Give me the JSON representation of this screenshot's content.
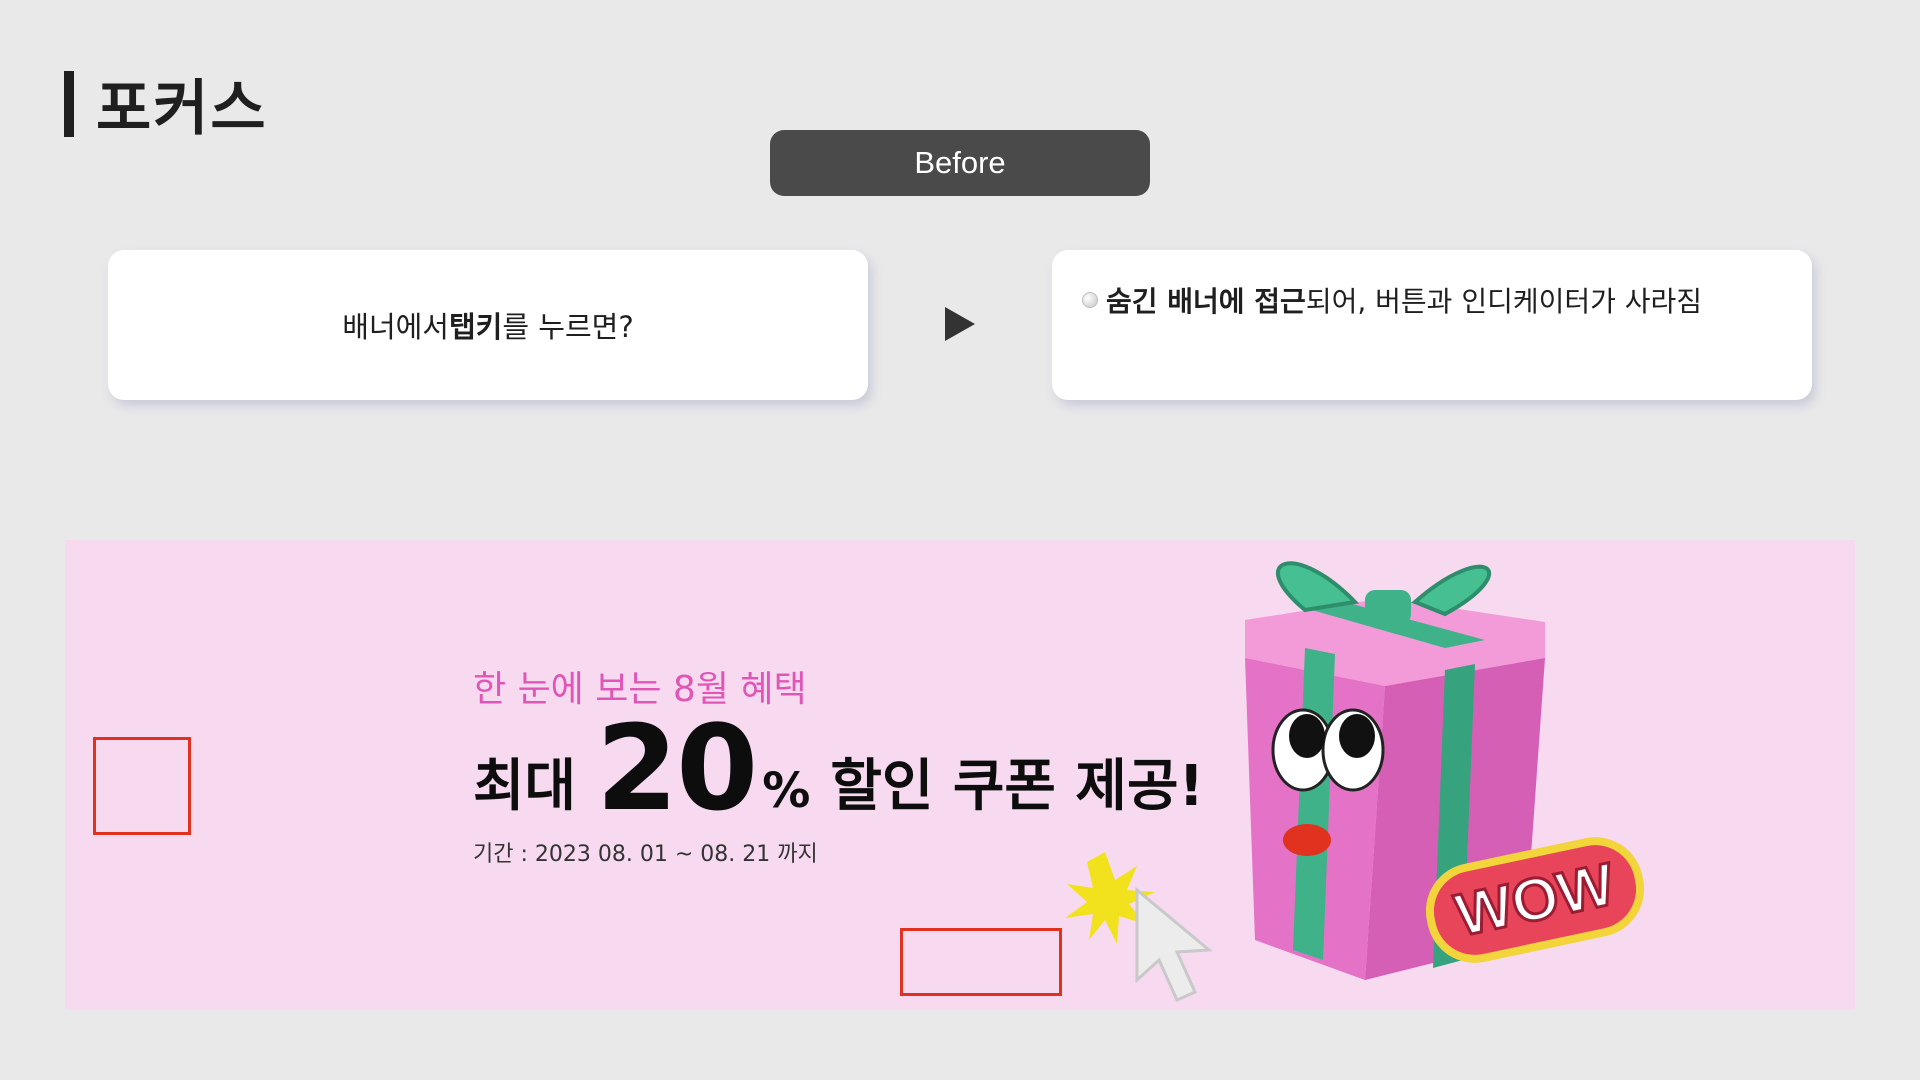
{
  "page": {
    "title": "포커스"
  },
  "label": {
    "before": "Before"
  },
  "left_card": {
    "prefix": "배너에서 ",
    "bold": "탭키",
    "suffix": "를 누르면?"
  },
  "right_card": {
    "bold": "숨긴 배너에 접근",
    "rest": "되어, 버튼과 인디케이터가 사라짐"
  },
  "banner": {
    "subtitle": "한 눈에 보는 8월 혜택",
    "headline_prefix": "최대",
    "headline_number": "20",
    "headline_percent": "%",
    "headline_suffix": "할인 쿠폰 제공!",
    "period": "기간 : 2023 08. 01 ~ 08. 21 까지",
    "sticker": "WOW"
  },
  "colors": {
    "background": "#e9e9ea",
    "pill": "#4a4a4a",
    "banner_bg": "#f7daf0",
    "subtitle": "#e056b6",
    "focus_outline": "#e0321f",
    "gift_pink": "#ea79cf",
    "ribbon_green": "#3fb28a"
  },
  "icons": [
    "arrow-right-icon",
    "bullet-icon",
    "gift-box-icon",
    "cursor-icon",
    "burst-icon"
  ]
}
